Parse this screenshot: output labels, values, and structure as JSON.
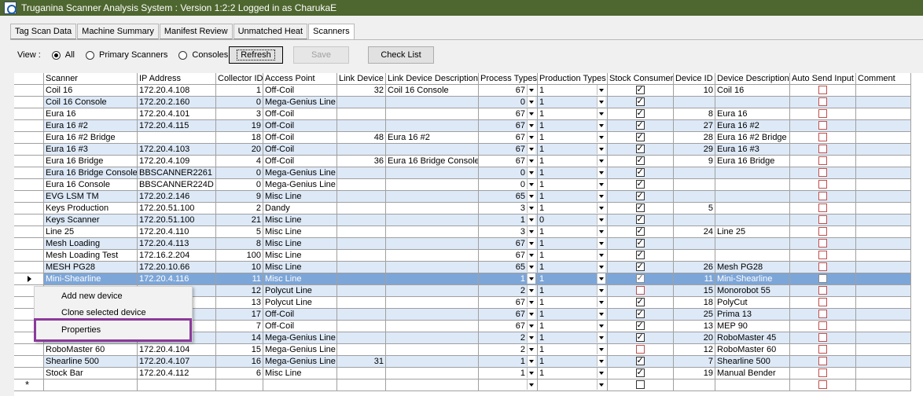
{
  "window": {
    "title": "Truganina Scanner Analysis System : Version 1:2:2 Logged in as CharukaE"
  },
  "tabs": [
    {
      "label": "Tag Scan Data"
    },
    {
      "label": "Machine Summary"
    },
    {
      "label": "Manifest Review"
    },
    {
      "label": "Unmatched Heat"
    },
    {
      "label": "Scanners"
    }
  ],
  "active_tab": "Scanners",
  "view": {
    "label": "View :",
    "options": [
      {
        "label": "All",
        "checked": true
      },
      {
        "label": "Primary Scanners",
        "checked": false
      },
      {
        "label": "Consoles",
        "checked": false
      }
    ]
  },
  "buttons": {
    "refresh": "Refresh",
    "save": "Save",
    "check_list": "Check List"
  },
  "columns": [
    "Scanner",
    "IP Address",
    "Collector ID",
    "Access Point",
    "Link Device",
    "Link Device Description",
    "Process Types",
    "Production Types",
    "Stock Consumer",
    "Device ID",
    "Device Description",
    "Auto Send Input",
    "Comment"
  ],
  "rows": [
    {
      "scanner": "Coil 16",
      "ip": "172.20.4.108",
      "collector": "1",
      "ap": "Off-Coil",
      "link": "32",
      "link_desc": "Coil 16 Console",
      "proc": "67",
      "prod": "1",
      "stock": true,
      "dev_id": "10",
      "dev_desc": "Coil 16",
      "auto": false
    },
    {
      "scanner": "Coil 16 Console",
      "ip": "172.20.2.160",
      "collector": "0",
      "ap": "Mega-Genius Line",
      "link": "",
      "link_desc": "",
      "proc": "0",
      "prod": "1",
      "stock": true,
      "dev_id": "",
      "dev_desc": "",
      "auto": false
    },
    {
      "scanner": "Eura 16",
      "ip": "172.20.4.101",
      "collector": "3",
      "ap": "Off-Coil",
      "link": "",
      "link_desc": "",
      "proc": "67",
      "prod": "1",
      "stock": true,
      "dev_id": "8",
      "dev_desc": "Eura 16",
      "auto": false
    },
    {
      "scanner": "Eura 16 #2",
      "ip": "172.20.4.115",
      "collector": "19",
      "ap": "Off-Coil",
      "link": "",
      "link_desc": "",
      "proc": "67",
      "prod": "1",
      "stock": true,
      "dev_id": "27",
      "dev_desc": "Eura 16 #2",
      "auto": false
    },
    {
      "scanner": "Eura 16 #2 Bridge",
      "ip": "",
      "collector": "18",
      "ap": "Off-Coil",
      "link": "48",
      "link_desc": "Eura 16 #2",
      "proc": "67",
      "prod": "1",
      "stock": true,
      "dev_id": "28",
      "dev_desc": "Eura 16 #2 Bridge",
      "auto": false
    },
    {
      "scanner": "Eura 16 #3",
      "ip": "172.20.4.103",
      "collector": "20",
      "ap": "Off-Coil",
      "link": "",
      "link_desc": "",
      "proc": "67",
      "prod": "1",
      "stock": true,
      "dev_id": "29",
      "dev_desc": "Eura 16 #3",
      "auto": false
    },
    {
      "scanner": "Eura 16 Bridge",
      "ip": "172.20.4.109",
      "collector": "4",
      "ap": "Off-Coil",
      "link": "36",
      "link_desc": "Eura 16 Bridge Console",
      "proc": "67",
      "prod": "1",
      "stock": true,
      "dev_id": "9",
      "dev_desc": "Eura 16 Bridge",
      "auto": false
    },
    {
      "scanner": "Eura 16 Bridge Console",
      "ip": "BBSCANNER2261",
      "collector": "0",
      "ap": "Mega-Genius Line",
      "link": "",
      "link_desc": "",
      "proc": "0",
      "prod": "1",
      "stock": true,
      "dev_id": "",
      "dev_desc": "",
      "auto": false
    },
    {
      "scanner": "Eura 16 Console",
      "ip": "BBSCANNER224D",
      "collector": "0",
      "ap": "Mega-Genius Line",
      "link": "",
      "link_desc": "",
      "proc": "0",
      "prod": "1",
      "stock": true,
      "dev_id": "",
      "dev_desc": "",
      "auto": false
    },
    {
      "scanner": "EVG LSM TM",
      "ip": "172.20.2.146",
      "collector": "9",
      "ap": "Misc Line",
      "link": "",
      "link_desc": "",
      "proc": "65",
      "prod": "1",
      "stock": true,
      "dev_id": "",
      "dev_desc": "",
      "auto": false
    },
    {
      "scanner": "Keys Production",
      "ip": "172.20.51.100",
      "collector": "2",
      "ap": "Dandy",
      "link": "",
      "link_desc": "",
      "proc": "3",
      "prod": "1",
      "stock": true,
      "dev_id": "5",
      "dev_desc": "",
      "auto": false
    },
    {
      "scanner": "Keys Scanner",
      "ip": "172.20.51.100",
      "collector": "21",
      "ap": "Misc Line",
      "link": "",
      "link_desc": "",
      "proc": "1",
      "prod": "0",
      "stock": true,
      "dev_id": "",
      "dev_desc": "",
      "auto": false
    },
    {
      "scanner": "Line 25",
      "ip": "172.20.4.110",
      "collector": "5",
      "ap": "Misc Line",
      "link": "",
      "link_desc": "",
      "proc": "3",
      "prod": "1",
      "stock": true,
      "dev_id": "24",
      "dev_desc": "Line 25",
      "auto": false
    },
    {
      "scanner": "Mesh Loading",
      "ip": "172.20.4.113",
      "collector": "8",
      "ap": "Misc Line",
      "link": "",
      "link_desc": "",
      "proc": "67",
      "prod": "1",
      "stock": true,
      "dev_id": "",
      "dev_desc": "",
      "auto": false
    },
    {
      "scanner": "Mesh Loading Test",
      "ip": "172.16.2.204",
      "collector": "100",
      "ap": "Misc Line",
      "link": "",
      "link_desc": "",
      "proc": "67",
      "prod": "1",
      "stock": true,
      "dev_id": "",
      "dev_desc": "",
      "auto": false
    },
    {
      "scanner": "MESH PG28",
      "ip": "172.20.10.66",
      "collector": "10",
      "ap": "Misc Line",
      "link": "",
      "link_desc": "",
      "proc": "65",
      "prod": "1",
      "stock": true,
      "dev_id": "26",
      "dev_desc": "Mesh PG28",
      "auto": false
    },
    {
      "scanner": "Mini-Shearline",
      "ip": "172.20.4.116",
      "collector": "11",
      "ap": "Misc Line",
      "link": "",
      "link_desc": "",
      "proc": "1",
      "prod": "1",
      "stock": true,
      "dev_id": "11",
      "dev_desc": "Mini-Shearline",
      "auto": false,
      "selected": true
    },
    {
      "scanner": "",
      "ip": "",
      "collector": "12",
      "ap": "Polycut Line",
      "link": "",
      "link_desc": "",
      "proc": "2",
      "prod": "1",
      "stock": false,
      "dev_id": "15",
      "dev_desc": "Monorobot 55",
      "auto": false
    },
    {
      "scanner": "",
      "ip": "",
      "collector": "13",
      "ap": "Polycut Line",
      "link": "",
      "link_desc": "",
      "proc": "67",
      "prod": "1",
      "stock": true,
      "dev_id": "18",
      "dev_desc": "PolyCut",
      "auto": false
    },
    {
      "scanner": "",
      "ip": "",
      "collector": "17",
      "ap": "Off-Coil",
      "link": "",
      "link_desc": "",
      "proc": "67",
      "prod": "1",
      "stock": true,
      "dev_id": "25",
      "dev_desc": "Prima 13",
      "auto": false
    },
    {
      "scanner": "",
      "ip": "",
      "collector": "7",
      "ap": "Off-Coil",
      "link": "",
      "link_desc": "",
      "proc": "67",
      "prod": "1",
      "stock": true,
      "dev_id": "13",
      "dev_desc": "MEP 90",
      "auto": false
    },
    {
      "scanner": "",
      "ip": "",
      "collector": "14",
      "ap": "Mega-Genius Line",
      "link": "",
      "link_desc": "",
      "proc": "2",
      "prod": "1",
      "stock": true,
      "dev_id": "20",
      "dev_desc": "RoboMaster 45",
      "auto": false
    },
    {
      "scanner": "RoboMaster 60",
      "ip": "172.20.4.104",
      "collector": "15",
      "ap": "Mega-Genius Line",
      "link": "",
      "link_desc": "",
      "proc": "2",
      "prod": "1",
      "stock": false,
      "dev_id": "12",
      "dev_desc": "RoboMaster 60",
      "auto": false
    },
    {
      "scanner": "Shearline 500",
      "ip": "172.20.4.107",
      "collector": "16",
      "ap": "Mega-Genius Line",
      "link": "31",
      "link_desc": "",
      "proc": "1",
      "prod": "1",
      "stock": true,
      "dev_id": "7",
      "dev_desc": "Shearline 500",
      "auto": false
    },
    {
      "scanner": "Stock Bar",
      "ip": "172.20.4.112",
      "collector": "6",
      "ap": "Misc Line",
      "link": "",
      "link_desc": "",
      "proc": "1",
      "prod": "1",
      "stock": true,
      "dev_id": "19",
      "dev_desc": "Manual Bender",
      "auto": false
    }
  ],
  "new_row_marker": "*",
  "context_menu": {
    "items": [
      "Add new device",
      "Clone selected device",
      "Properties"
    ],
    "highlighted": "Properties"
  },
  "colors": {
    "titlebar": "#4e662f",
    "row_alt": "#dde9f7",
    "row_selected": "#7da6d8",
    "highlight_box": "#8b3a9a"
  }
}
